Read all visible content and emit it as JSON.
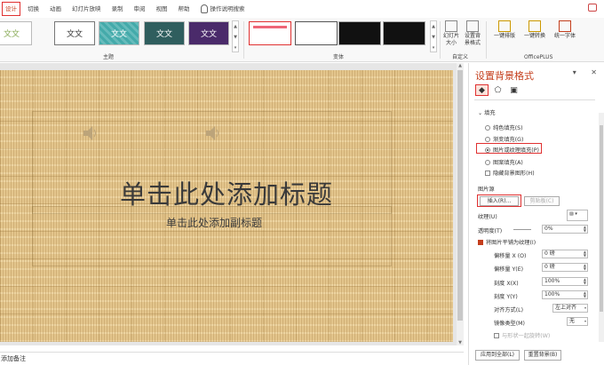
{
  "tabs": [
    "设计",
    "切换",
    "动画",
    "幻灯片放映",
    "录制",
    "审阅",
    "视图",
    "帮助",
    "操作说明搜索"
  ],
  "ribbon": {
    "theme_label": "主题",
    "variant_label": "变体",
    "custom_label": "自定义",
    "office_label": "OfficePLUS",
    "themes": [
      "文文",
      "文文",
      "文文",
      "文文",
      "文文"
    ],
    "slide_size": [
      "幻灯片",
      "大小"
    ],
    "format_bg": [
      "设置背",
      "景格式"
    ],
    "one_key_layout": "一键排版",
    "one_key_convert": "一键转换",
    "unify_font": "统一字体"
  },
  "slide": {
    "title": "单击此处添加标题",
    "subtitle": "单击此处添加副标题"
  },
  "notes": "添加备注",
  "pane": {
    "title": "设置背景格式",
    "fill_header": "填充",
    "fill_options": [
      "纯色填充(S)",
      "渐变填充(G)",
      "图片或纹理填充(P)",
      "图案填充(A)"
    ],
    "hide_bg": "隐藏背景图形(H)",
    "picture_source": "图片源",
    "insert_btn": "插入(R)...",
    "clipboard_btn": "剪贴板(C)",
    "texture_label": "纹理(U)",
    "transparency_label": "透明度(T)",
    "transparency_value": "0%",
    "tile_label": "将图片平铺为纹理(I)",
    "offset_x_label": "偏移量 X (O)",
    "offset_x_value": "0 磅",
    "offset_y_label": "偏移量 Y(E)",
    "offset_y_value": "0 磅",
    "scale_x_label": "刻度 X(X)",
    "scale_x_value": "100%",
    "scale_y_label": "刻度 Y(Y)",
    "scale_y_value": "100%",
    "align_label": "对齐方式(L)",
    "align_value": "左上对齐",
    "mirror_label": "镜像类型(M)",
    "mirror_value": "无",
    "rotate_label": "与形状一起旋转(W)",
    "apply_all": "应用到全部(L)",
    "reset_bg": "重置背景(B)"
  },
  "colors": {
    "accent": "#c43e1c",
    "highlight_box": "#e03030",
    "texture": "#e3c58c"
  }
}
